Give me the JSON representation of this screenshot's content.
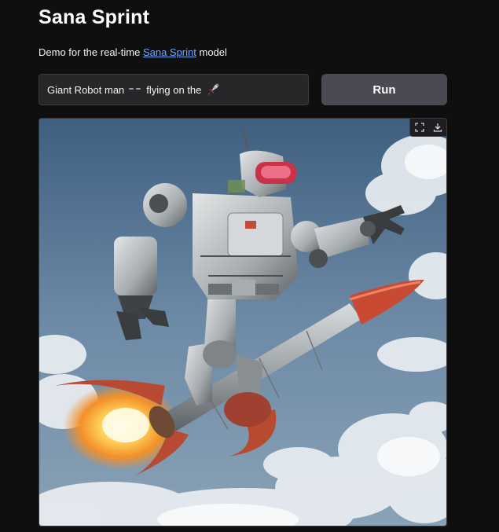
{
  "header": {
    "title": "Sana Sprint",
    "subtitle_before": "Demo for the real-time ",
    "subtitle_link": "Sana Sprint",
    "subtitle_after": " model"
  },
  "prompt": {
    "text_start": "Giant Robot man",
    "text_end": "flying on the",
    "emoji_1": "robot-emoji",
    "emoji_2": "rocket-emoji"
  },
  "run_button": {
    "label": "Run"
  },
  "output_image": {
    "subject": "generated-image",
    "toolbar": [
      "fullscreen-icon",
      "download-icon"
    ]
  },
  "colors": {
    "background": "#0f0f10",
    "input_bg": "#27272a",
    "button_bg": "#4a4a52",
    "link": "#6ea8ff"
  }
}
